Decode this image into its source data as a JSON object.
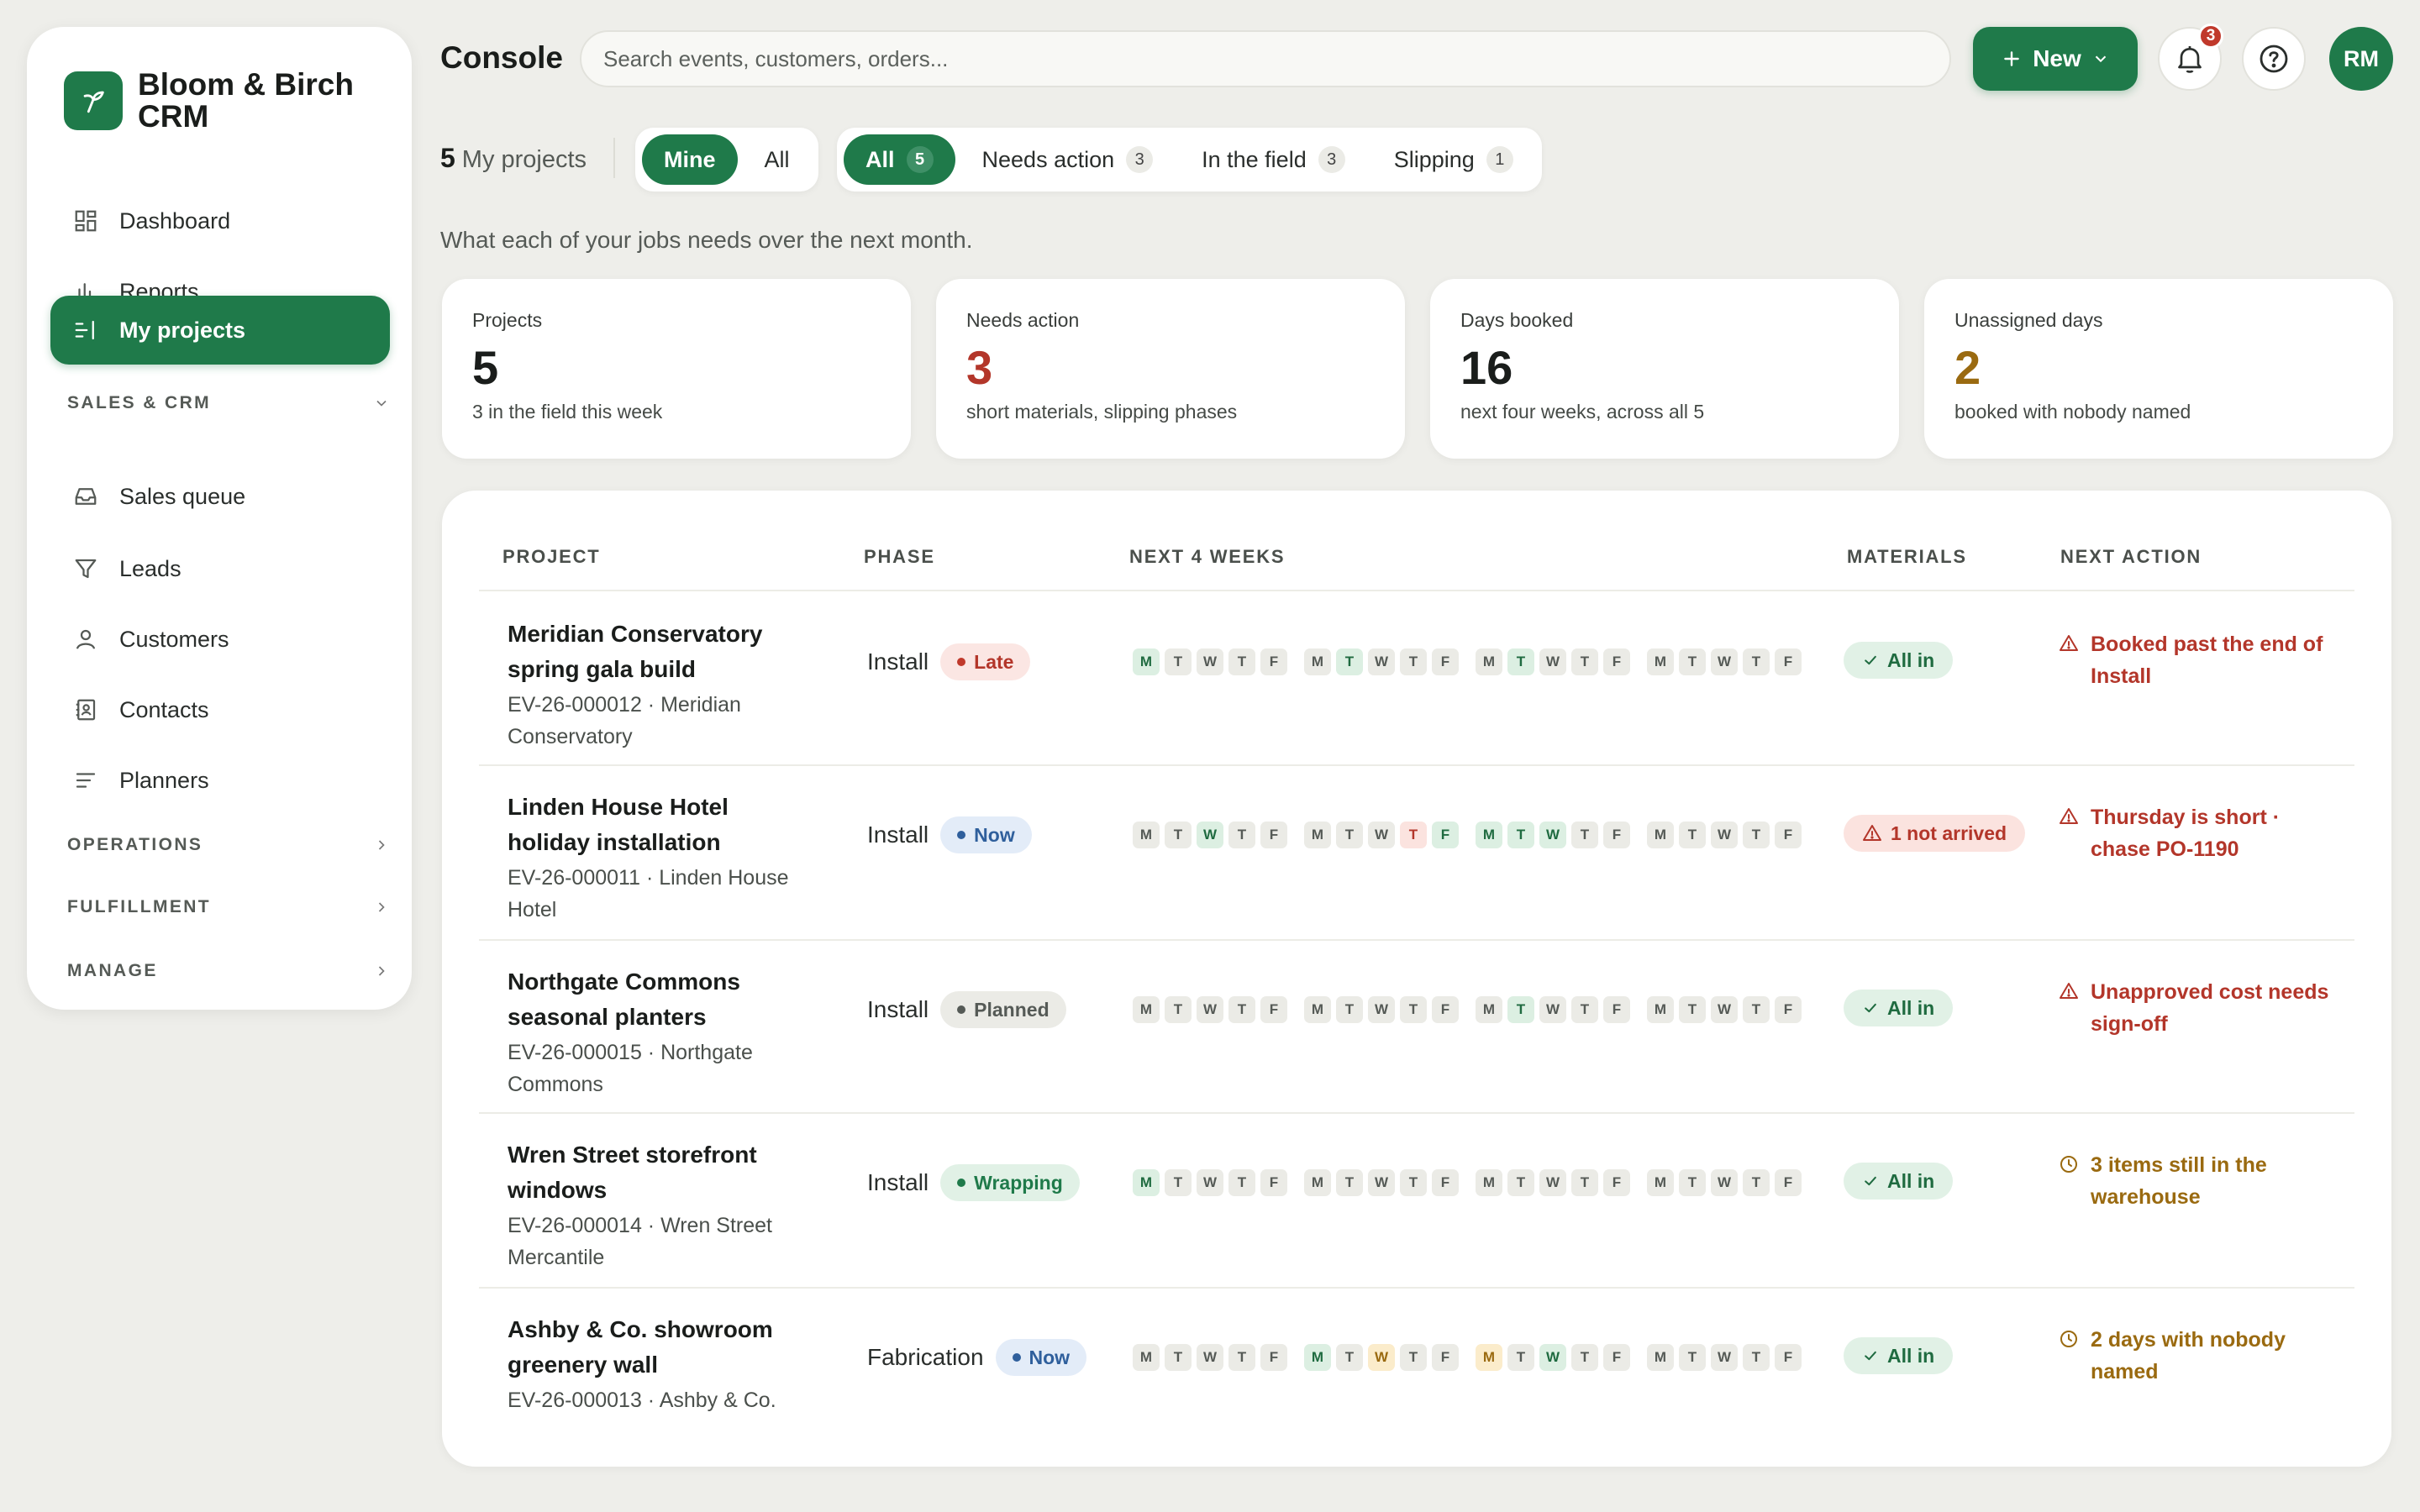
{
  "brand": {
    "name": "Bloom & Birch CRM"
  },
  "sidebar": {
    "items": [
      {
        "label": "Dashboard",
        "icon": "dashboard-icon"
      },
      {
        "label": "Reports",
        "icon": "bar-chart-icon"
      },
      {
        "label": "My projects",
        "icon": "list-icon",
        "active": true
      }
    ],
    "sections": {
      "sales": {
        "label": "SALES & CRM"
      },
      "operations": {
        "label": "OPERATIONS"
      },
      "fulfillment": {
        "label": "FULFILLMENT"
      },
      "manage": {
        "label": "MANAGE"
      }
    },
    "sales_items": [
      {
        "label": "Sales queue",
        "icon": "inbox-icon"
      },
      {
        "label": "Leads",
        "icon": "funnel-icon"
      },
      {
        "label": "Customers",
        "icon": "person-icon"
      },
      {
        "label": "Contacts",
        "icon": "contact-book-icon"
      },
      {
        "label": "Planners",
        "icon": "lines-icon"
      }
    ]
  },
  "header": {
    "title": "Console",
    "search_placeholder": "Search events, customers, orders...",
    "new_label": "New",
    "notification_count": "3",
    "avatar_initials": "RM"
  },
  "filters": {
    "count": "5",
    "count_label": "My projects",
    "owner": [
      {
        "label": "Mine",
        "active": true
      },
      {
        "label": "All"
      }
    ],
    "status": [
      {
        "label": "All",
        "count": "5",
        "active": true
      },
      {
        "label": "Needs action",
        "count": "3"
      },
      {
        "label": "In the field",
        "count": "3"
      },
      {
        "label": "Slipping",
        "count": "1"
      }
    ]
  },
  "subtitle": "What each of your jobs needs over the next month.",
  "stats": [
    {
      "label": "Projects",
      "value": "5",
      "note": "3 in the field this week",
      "color": "#1a1d1b"
    },
    {
      "label": "Needs action",
      "value": "3",
      "note": "short materials, slipping phases",
      "color": "#b3362a"
    },
    {
      "label": "Days booked",
      "value": "16",
      "note": "next four weeks, across all 5",
      "color": "#1a1d1b"
    },
    {
      "label": "Unassigned days",
      "value": "2",
      "note": "booked with nobody named",
      "color": "#9a6a10"
    }
  ],
  "table": {
    "headers": {
      "project": "PROJECT",
      "phase": "PHASE",
      "weeks": "NEXT 4 WEEKS",
      "materials": "MATERIALS",
      "action": "NEXT ACTION"
    },
    "rows": [
      {
        "name": "Meridian Conservatory spring gala build",
        "sub": "EV-26-000012 · Meridian Conservatory",
        "phase": "Install",
        "status": "Late",
        "status_class": "late",
        "days": [
          "g",
          "n",
          "n",
          "n",
          "n",
          "n",
          "g",
          "n",
          "n",
          "n",
          "n",
          "g",
          "n",
          "n",
          "n",
          "n",
          "n",
          "n",
          "n",
          "n"
        ],
        "materials": "All in",
        "materials_state": "ok",
        "action": "Booked past the end of Install",
        "action_tone": "red"
      },
      {
        "name": "Linden House Hotel holiday installation",
        "sub": "EV-26-000011 · Linden House Hotel",
        "phase": "Install",
        "status": "Now",
        "status_class": "now",
        "days": [
          "n",
          "n",
          "g",
          "n",
          "n",
          "n",
          "n",
          "n",
          "r",
          "g",
          "g",
          "g",
          "g",
          "n",
          "n",
          "n",
          "n",
          "n",
          "n",
          "n"
        ],
        "materials": "1 not arrived",
        "materials_state": "bad",
        "action": "Thursday is short · chase PO-1190",
        "action_tone": "red"
      },
      {
        "name": "Northgate Commons seasonal planters",
        "sub": "EV-26-000015 · Northgate Commons",
        "phase": "Install",
        "status": "Planned",
        "status_class": "planned",
        "days": [
          "n",
          "n",
          "n",
          "n",
          "n",
          "n",
          "n",
          "n",
          "n",
          "n",
          "n",
          "g",
          "n",
          "n",
          "n",
          "n",
          "n",
          "n",
          "n",
          "n"
        ],
        "materials": "All in",
        "materials_state": "ok",
        "action": "Unapproved cost needs sign-off",
        "action_tone": "red"
      },
      {
        "name": "Wren Street storefront windows",
        "sub": "EV-26-000014 · Wren Street Mercantile",
        "phase": "Install",
        "status": "Wrapping",
        "status_class": "wrapping",
        "days": [
          "g",
          "n",
          "n",
          "n",
          "n",
          "n",
          "n",
          "n",
          "n",
          "n",
          "n",
          "n",
          "n",
          "n",
          "n",
          "n",
          "n",
          "n",
          "n",
          "n"
        ],
        "materials": "All in",
        "materials_state": "ok",
        "action": "3 items still in the warehouse",
        "action_tone": "amber"
      },
      {
        "name": "Ashby & Co. showroom greenery wall",
        "sub": "EV-26-000013 · Ashby & Co.",
        "phase": "Fabrication",
        "status": "Now",
        "status_class": "now",
        "days": [
          "n",
          "n",
          "n",
          "n",
          "n",
          "g",
          "n",
          "o",
          "n",
          "n",
          "o",
          "n",
          "g",
          "n",
          "n",
          "n",
          "n",
          "n",
          "n",
          "n"
        ],
        "materials": "All in",
        "materials_state": "ok",
        "action": "2 days with nobody named",
        "action_tone": "amber"
      }
    ],
    "day_letters": [
      "M",
      "T",
      "W",
      "T",
      "F"
    ]
  }
}
